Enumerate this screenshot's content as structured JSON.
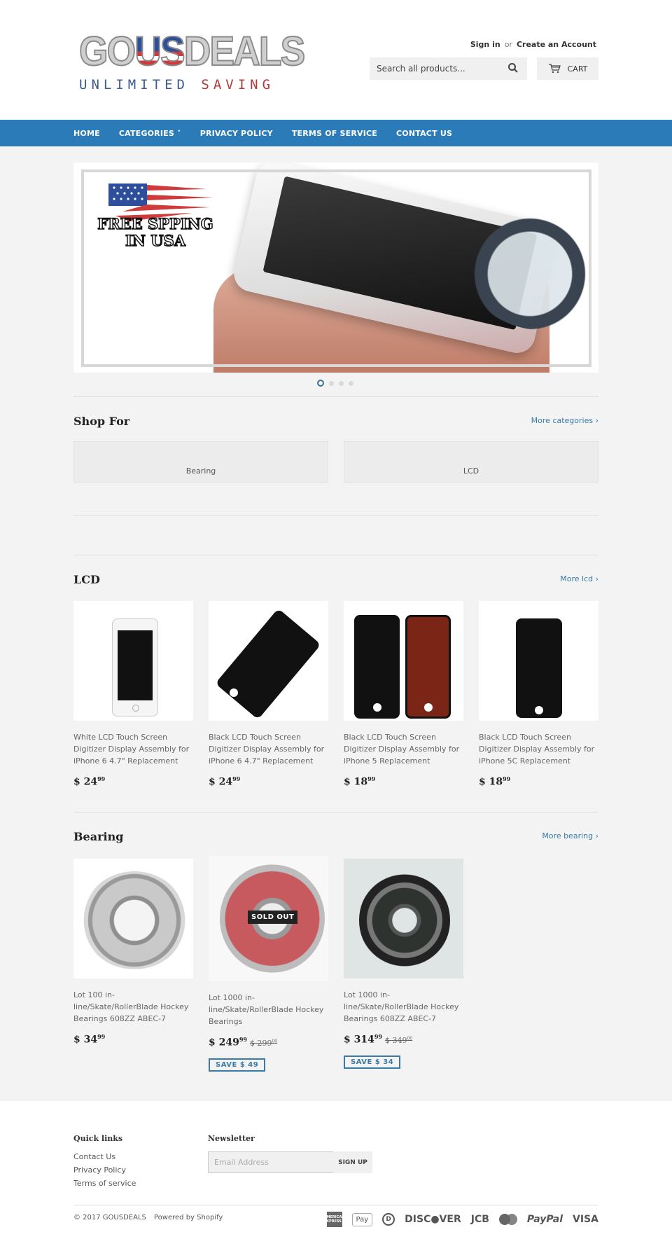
{
  "header": {
    "logo": {
      "main_left": "GO",
      "main_flag": "US",
      "main_right": "DEALS",
      "tagline_left": "UNLIMITED",
      "tagline_right": "SAVING"
    },
    "account": {
      "sign_in": "Sign in",
      "or": "or",
      "create": "Create an Account"
    },
    "search": {
      "placeholder": "Search all products...",
      "value": ""
    },
    "cart_label": "CART"
  },
  "nav": {
    "items": [
      {
        "label": "HOME"
      },
      {
        "label": "CATEGORIES ˅"
      },
      {
        "label": "PRIVACY POLICY"
      },
      {
        "label": "TERMS OF SERVICE"
      },
      {
        "label": "CONTACT US"
      }
    ]
  },
  "hero": {
    "slide_text_line1": "FREE SPPING",
    "slide_text_line2": "IN USA",
    "slide_count": 4,
    "active_slide": 1
  },
  "shop_for": {
    "title": "Shop For",
    "more": "More categories ›",
    "categories": [
      {
        "label": "Bearing"
      },
      {
        "label": "LCD"
      }
    ]
  },
  "lcd": {
    "title": "LCD",
    "more": "More lcd ›",
    "products": [
      {
        "title": "White LCD Touch Screen Digitizer Display Assembly for iPhone 6 4.7\" Replacement",
        "price_main": "$ 24",
        "price_cents": "99"
      },
      {
        "title": "Black LCD Touch Screen Digitizer Display Assembly for iPhone 6 4.7\" Replacement",
        "price_main": "$ 24",
        "price_cents": "99"
      },
      {
        "title": "Black LCD Touch Screen Digitizer Display Assembly for iPhone 5 Replacement",
        "price_main": "$ 18",
        "price_cents": "99"
      },
      {
        "title": "Black LCD Touch Screen Digitizer Display Assembly for iPhone 5C Replacement",
        "price_main": "$ 18",
        "price_cents": "99"
      }
    ]
  },
  "bearing": {
    "title": "Bearing",
    "more": "More bearing ›",
    "products": [
      {
        "title": "Lot 100 in-line/Skate/RollerBlade Hockey Bearings 608ZZ ABEC-7",
        "price_main": "$ 34",
        "price_cents": "99"
      },
      {
        "title": "Lot 1000 in-line/Skate/RollerBlade Hockey Bearings",
        "price_main": "$ 249",
        "price_cents": "99",
        "old_main": "$ 299",
        "old_cents": "00",
        "save": "SAVE $ 49",
        "badge": "SOLD OUT"
      },
      {
        "title": "Lot 1000 in-line/Skate/RollerBlade Hockey Bearings 608ZZ ABEC-7",
        "price_main": "$ 314",
        "price_cents": "99",
        "old_main": "$ 349",
        "old_cents": "00",
        "save": "SAVE $ 34"
      }
    ]
  },
  "footer": {
    "quick_links_title": "Quick links",
    "quick_links": [
      {
        "label": "Contact Us"
      },
      {
        "label": "Privacy Policy"
      },
      {
        "label": "Terms of service"
      }
    ],
    "newsletter_title": "Newsletter",
    "email_placeholder": "Email Address",
    "signup_label": "SIGN UP",
    "copyright": "© 2017 GOUSDEALS",
    "powered": "Powered by Shopify",
    "payments": {
      "amex": "AMERICAN EXPRESS",
      "apple": " Pay",
      "diners": "D",
      "discover": "DISC●VER",
      "jcb": "JCB",
      "mastercard": "MasterCard",
      "paypal": "PayPal",
      "visa": "VISA"
    }
  }
}
